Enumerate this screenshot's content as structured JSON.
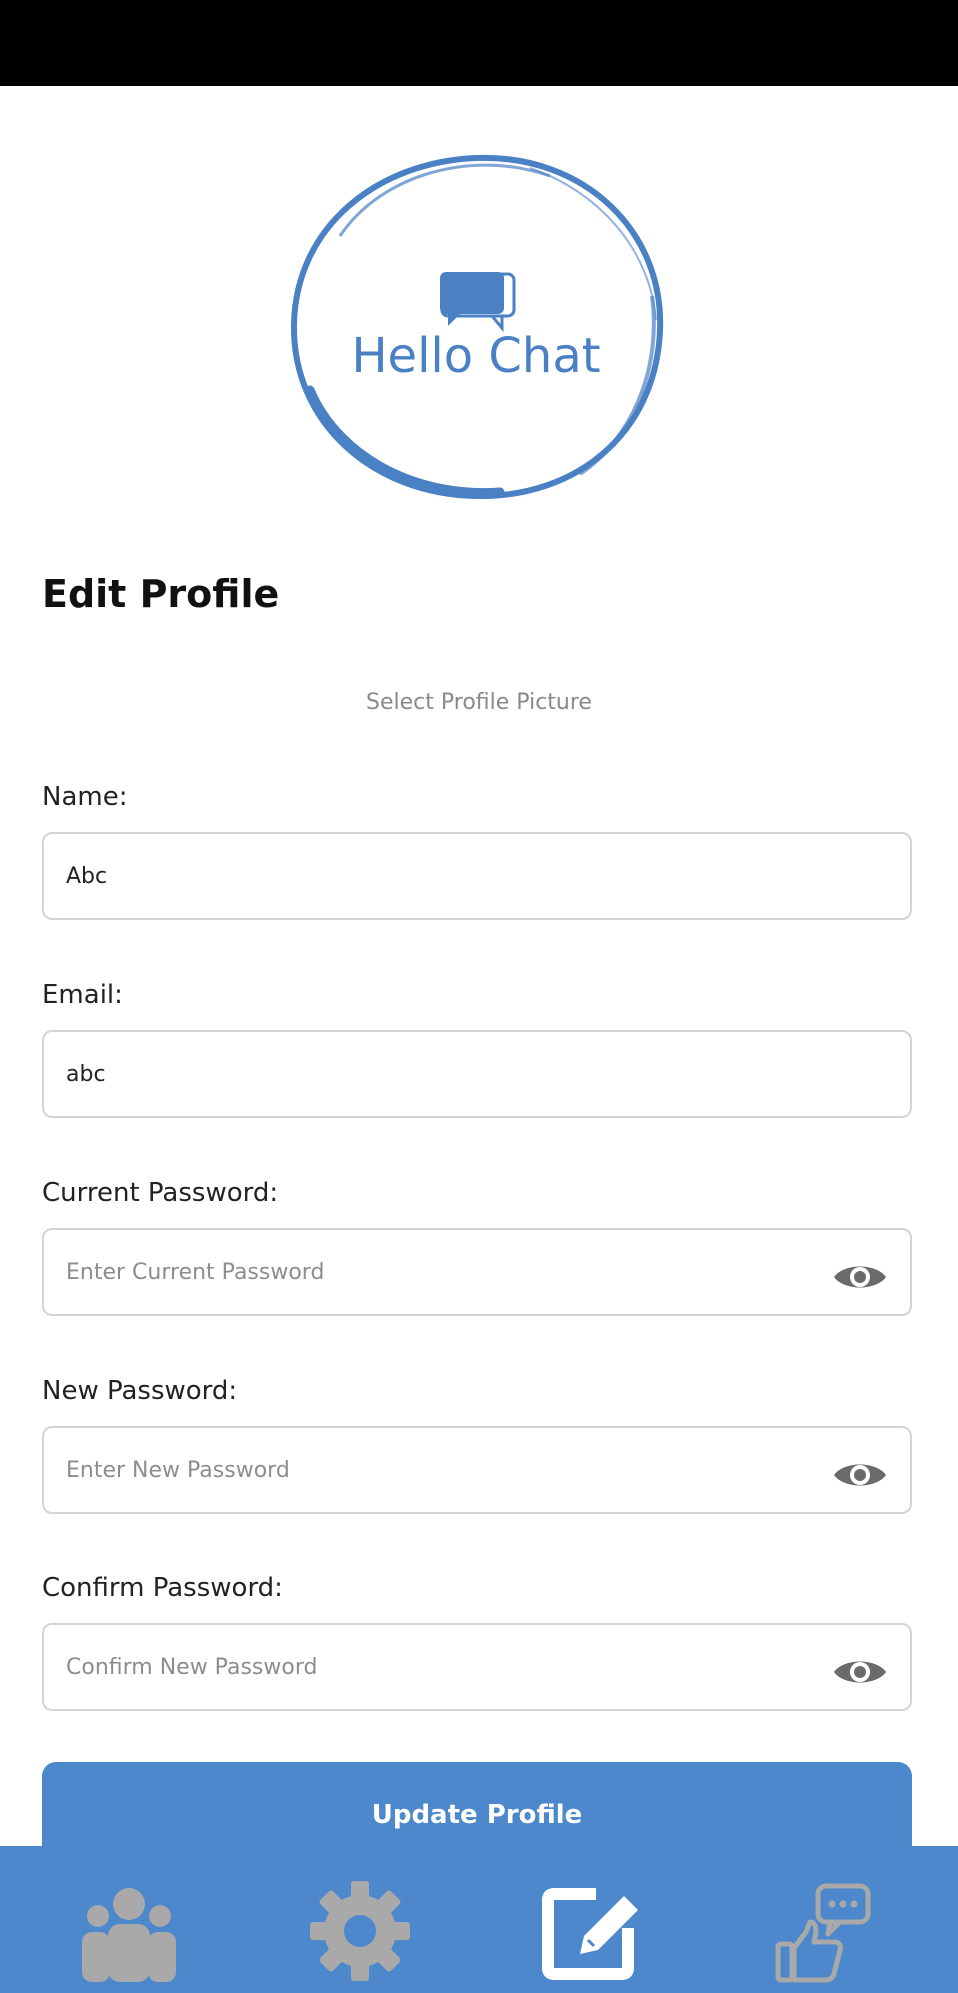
{
  "app": {
    "logo_text": "Hello Chat"
  },
  "page": {
    "title": "Edit Profile",
    "select_picture_label": "Select Profile Picture"
  },
  "form": {
    "name": {
      "label": "Name:",
      "value": "Abc",
      "placeholder": ""
    },
    "email": {
      "label": "Email:",
      "value": "abc",
      "placeholder": ""
    },
    "current_password": {
      "label": "Current Password:",
      "value": "",
      "placeholder": "Enter Current Password",
      "visibility_icon": "eye-icon"
    },
    "new_password": {
      "label": "New Password:",
      "value": "",
      "placeholder": "Enter New Password",
      "visibility_icon": "eye-icon"
    },
    "confirm_password": {
      "label": "Confirm Password:",
      "value": "",
      "placeholder": "Confirm New Password",
      "visibility_icon": "eye-icon"
    },
    "submit_label": "Update Profile"
  },
  "bottom_nav": {
    "items": [
      {
        "icon": "users-icon"
      },
      {
        "icon": "gear-icon"
      },
      {
        "icon": "edit-icon",
        "active": true
      },
      {
        "icon": "feedback-icon"
      }
    ]
  },
  "colors": {
    "accent": "#4d87cc",
    "logo_blue": "#4a80c4",
    "nav_icon_inactive": "#a9a9a9",
    "nav_icon_active": "#ffffff",
    "eye_icon": "#6b6b6b",
    "input_border": "#d4d4d4",
    "status_bar": "#000000"
  }
}
